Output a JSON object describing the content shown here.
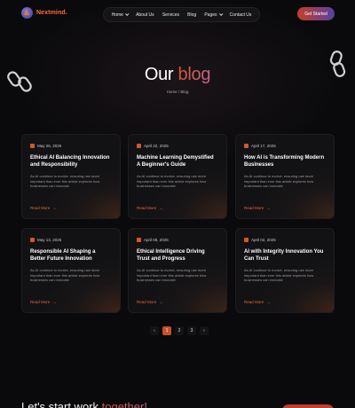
{
  "brand": {
    "name": "Nextmind."
  },
  "nav": {
    "items": [
      {
        "label": "Home",
        "dropdown": true
      },
      {
        "label": "About Us",
        "dropdown": false
      },
      {
        "label": "Services",
        "dropdown": false
      },
      {
        "label": "Blog",
        "dropdown": false
      },
      {
        "label": "Pages",
        "dropdown": true
      },
      {
        "label": "Contact Us",
        "dropdown": false
      }
    ],
    "cta_label": "Get Started"
  },
  "hero": {
    "title_main": "Our ",
    "title_accent": "blog",
    "breadcrumb": "Home  /  Blog"
  },
  "posts": [
    {
      "date": "May 26, 2025",
      "title": "Ethical AI Balancing Innovation and Responsibility",
      "excerpt": "As AI continue to evolve, ensuring use more important than ever this article explores how businesses can innovate",
      "link": "Read More"
    },
    {
      "date": "April 22, 2025",
      "title": "Machine Learning Demystified A Beginner's Guide",
      "excerpt": "As AI continue to evolve, ensuring use more important than ever this article explores how businesses can innovate",
      "link": "Read More"
    },
    {
      "date": "April 17, 2025",
      "title": "How AI is Transforming Modern Businesses",
      "excerpt": "As AI continue to evolve, ensuring use more important than ever this article explores how businesses can innovate",
      "link": "Read More"
    },
    {
      "date": "May 13, 2025",
      "title": "Responsible AI Shaping a Better Future Innovation",
      "excerpt": "As AI continue to evolve, ensuring use more important than ever this article explores how businesses can innovate",
      "link": "Read More"
    },
    {
      "date": "April 08, 2025",
      "title": "Ethical Intelligence Driving Trust and Progress",
      "excerpt": "As AI continue to evolve, ensuring use more important than ever this article explores how businesses can innovate",
      "link": "Read More"
    },
    {
      "date": "April 02, 2025",
      "title": "AI with Integrity Innovation You Can Trust",
      "excerpt": "As AI continue to evolve, ensuring use more important than ever this article explores how businesses can innovate",
      "link": "Read More"
    }
  ],
  "pagination": {
    "prev": "‹",
    "pages": [
      "1",
      "2",
      "3"
    ],
    "current": "1",
    "next": "›"
  },
  "footer": {
    "cta_main": "Let's start work ",
    "cta_accent": "together!"
  },
  "colors": {
    "accent": "#d1582f",
    "background": "#0a0a0c",
    "card": "#1a1617"
  },
  "icons": {
    "date": "calendar-icon",
    "read_more": "arrow-right-icon",
    "nav_dropdown": "chevron-down-icon"
  }
}
